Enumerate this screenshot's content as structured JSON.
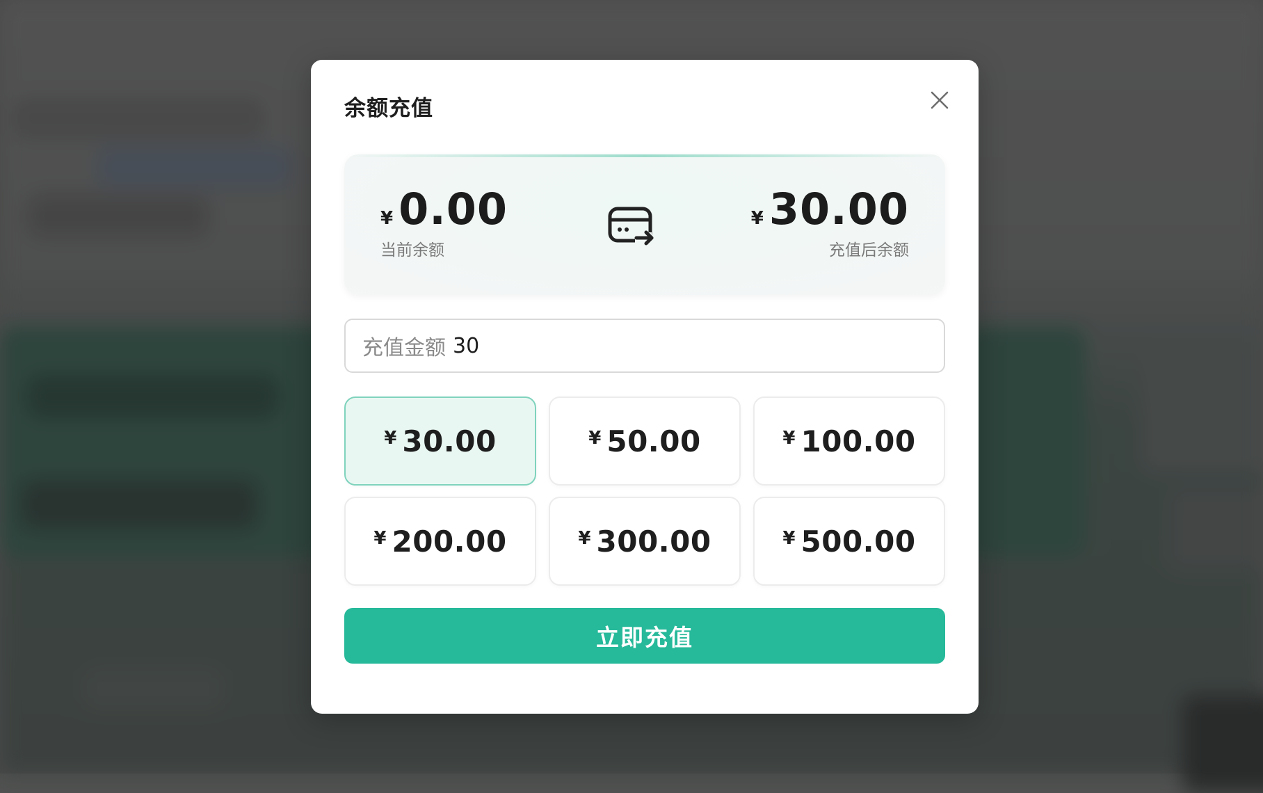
{
  "modal": {
    "title": "余额充值"
  },
  "balance": {
    "currency_symbol": "¥",
    "current_amount": "0.00",
    "current_label": "当前余额",
    "after_amount": "30.00",
    "after_label": "充值后余额"
  },
  "input": {
    "prefix": "充值金额",
    "value": "30"
  },
  "options": [
    {
      "symbol": "¥",
      "amount": "30.00",
      "selected": true
    },
    {
      "symbol": "¥",
      "amount": "50.00",
      "selected": false
    },
    {
      "symbol": "¥",
      "amount": "100.00",
      "selected": false
    },
    {
      "symbol": "¥",
      "amount": "200.00",
      "selected": false
    },
    {
      "symbol": "¥",
      "amount": "300.00",
      "selected": false
    },
    {
      "symbol": "¥",
      "amount": "500.00",
      "selected": false
    }
  ],
  "submit": {
    "label": "立即充值"
  },
  "colors": {
    "accent": "#26b99a",
    "selected_bg": "#e9f7f2",
    "selected_border": "#7fd3bd"
  },
  "icons": {
    "close": "close-icon",
    "transfer": "card-transfer-icon"
  }
}
